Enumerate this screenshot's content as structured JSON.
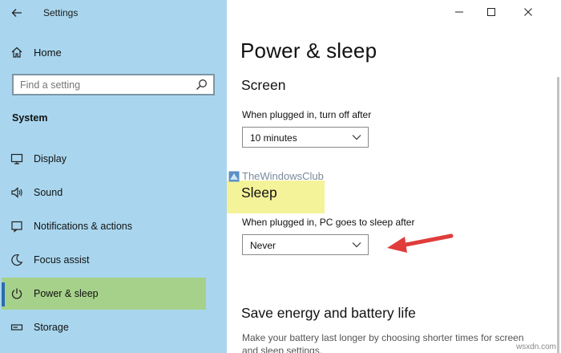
{
  "app": {
    "title": "Settings"
  },
  "sidebar": {
    "home_label": "Home",
    "search": {
      "placeholder": "Find a setting",
      "value": ""
    },
    "section_label": "System",
    "items": [
      {
        "label": "Display",
        "icon": "monitor-icon"
      },
      {
        "label": "Sound",
        "icon": "speaker-icon"
      },
      {
        "label": "Notifications & actions",
        "icon": "notifications-icon"
      },
      {
        "label": "Focus assist",
        "icon": "moon-icon"
      },
      {
        "label": "Power & sleep",
        "icon": "power-icon",
        "selected": true
      },
      {
        "label": "Storage",
        "icon": "storage-icon"
      }
    ]
  },
  "main": {
    "page_title": "Power & sleep",
    "screen": {
      "heading": "Screen",
      "label": "When plugged in, turn off after",
      "value": "10 minutes"
    },
    "sleep": {
      "heading": "Sleep",
      "label": "When plugged in, PC goes to sleep after",
      "value": "Never"
    },
    "save_energy": {
      "heading": "Save energy and battery life",
      "description": "Make your battery last longer by choosing shorter times for screen and sleep settings."
    },
    "watermark": "TheWindowsClub"
  },
  "footer_mark": "wsxdn.com",
  "colors": {
    "sidebar_bg": "#a9d6ee",
    "selected_bg": "#a6d18a",
    "highlight": "#f5f39a",
    "arrow": "#e03c3c"
  }
}
